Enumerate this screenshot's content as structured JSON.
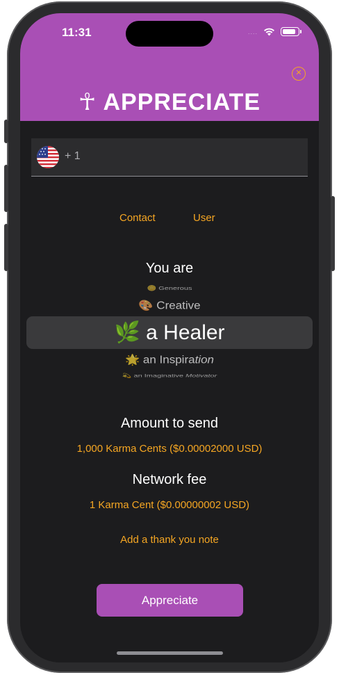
{
  "status_bar": {
    "time": "11:31",
    "signal": "....",
    "battery_level": 0.9
  },
  "header": {
    "title": "☥ APPRECIATE",
    "close_icon": "close-circle-icon",
    "background_color": "#a94fb5"
  },
  "phone_input": {
    "flag_icon": "us-flag-icon",
    "dial_code": "+ 1",
    "value": ""
  },
  "tabs": [
    {
      "label": "Contact"
    },
    {
      "label": "User"
    }
  ],
  "trait_picker": {
    "heading": "You are",
    "items": [
      {
        "emoji": "🪙",
        "text": "Generous",
        "italic": ""
      },
      {
        "emoji": "🎨",
        "text": "Creative",
        "italic": ""
      },
      {
        "emoji": "🌿",
        "text": "a Healer",
        "italic": ""
      },
      {
        "emoji": "🌟",
        "text": "an Inspira",
        "italic": "tion"
      },
      {
        "emoji": "💫",
        "text": "an Imaginative ",
        "italic": "Motivator"
      }
    ],
    "selected_index": 2
  },
  "amount": {
    "heading": "Amount to send",
    "value": "1,000 Karma Cents ($0.00002000 USD)"
  },
  "fee": {
    "heading": "Network fee",
    "value": "1 Karma Cent ($0.00000002 USD)"
  },
  "note_link": "Add a thank you note",
  "submit_label": "Appreciate",
  "colors": {
    "accent": "#f5a623",
    "brand": "#a94fb5",
    "background": "#1c1c1e"
  }
}
